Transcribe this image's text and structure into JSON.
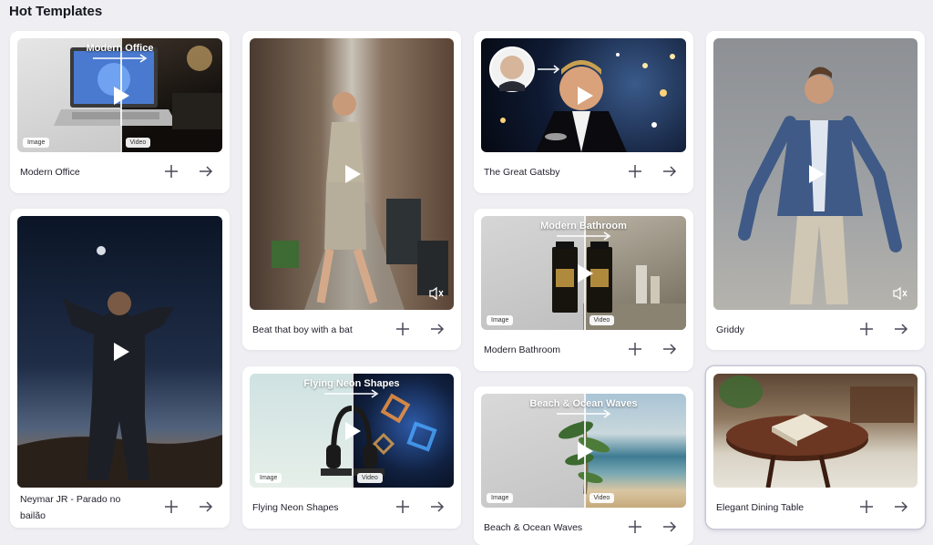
{
  "header": {
    "title": "Hot Templates"
  },
  "labels": {
    "image": "Image",
    "video": "Video"
  },
  "icons": {
    "play": "play-icon",
    "add": "plus-icon",
    "go": "arrow-right-icon",
    "mute": "speaker-muted-icon"
  },
  "cards": {
    "modern_office": {
      "name": "Modern Office",
      "overlay": "Modern Office"
    },
    "neymar": {
      "name_line1": "Neymar JR - Parado no",
      "name_line2": "bailão"
    },
    "beat_boy": {
      "name": "Beat that boy with a bat"
    },
    "flying_neon": {
      "name": "Flying Neon Shapes",
      "overlay": "Flying Neon Shapes"
    },
    "gatsby": {
      "name": "The Great Gatsby"
    },
    "modern_bathroom": {
      "name": "Modern Bathroom",
      "overlay": "Modern Bathroom"
    },
    "beach_ocean": {
      "name": "Beach & Ocean Waves",
      "overlay": "Beach & Ocean Waves"
    },
    "griddy": {
      "name": "Griddy"
    },
    "dining_table": {
      "name": "Elegant Dining Table"
    }
  }
}
